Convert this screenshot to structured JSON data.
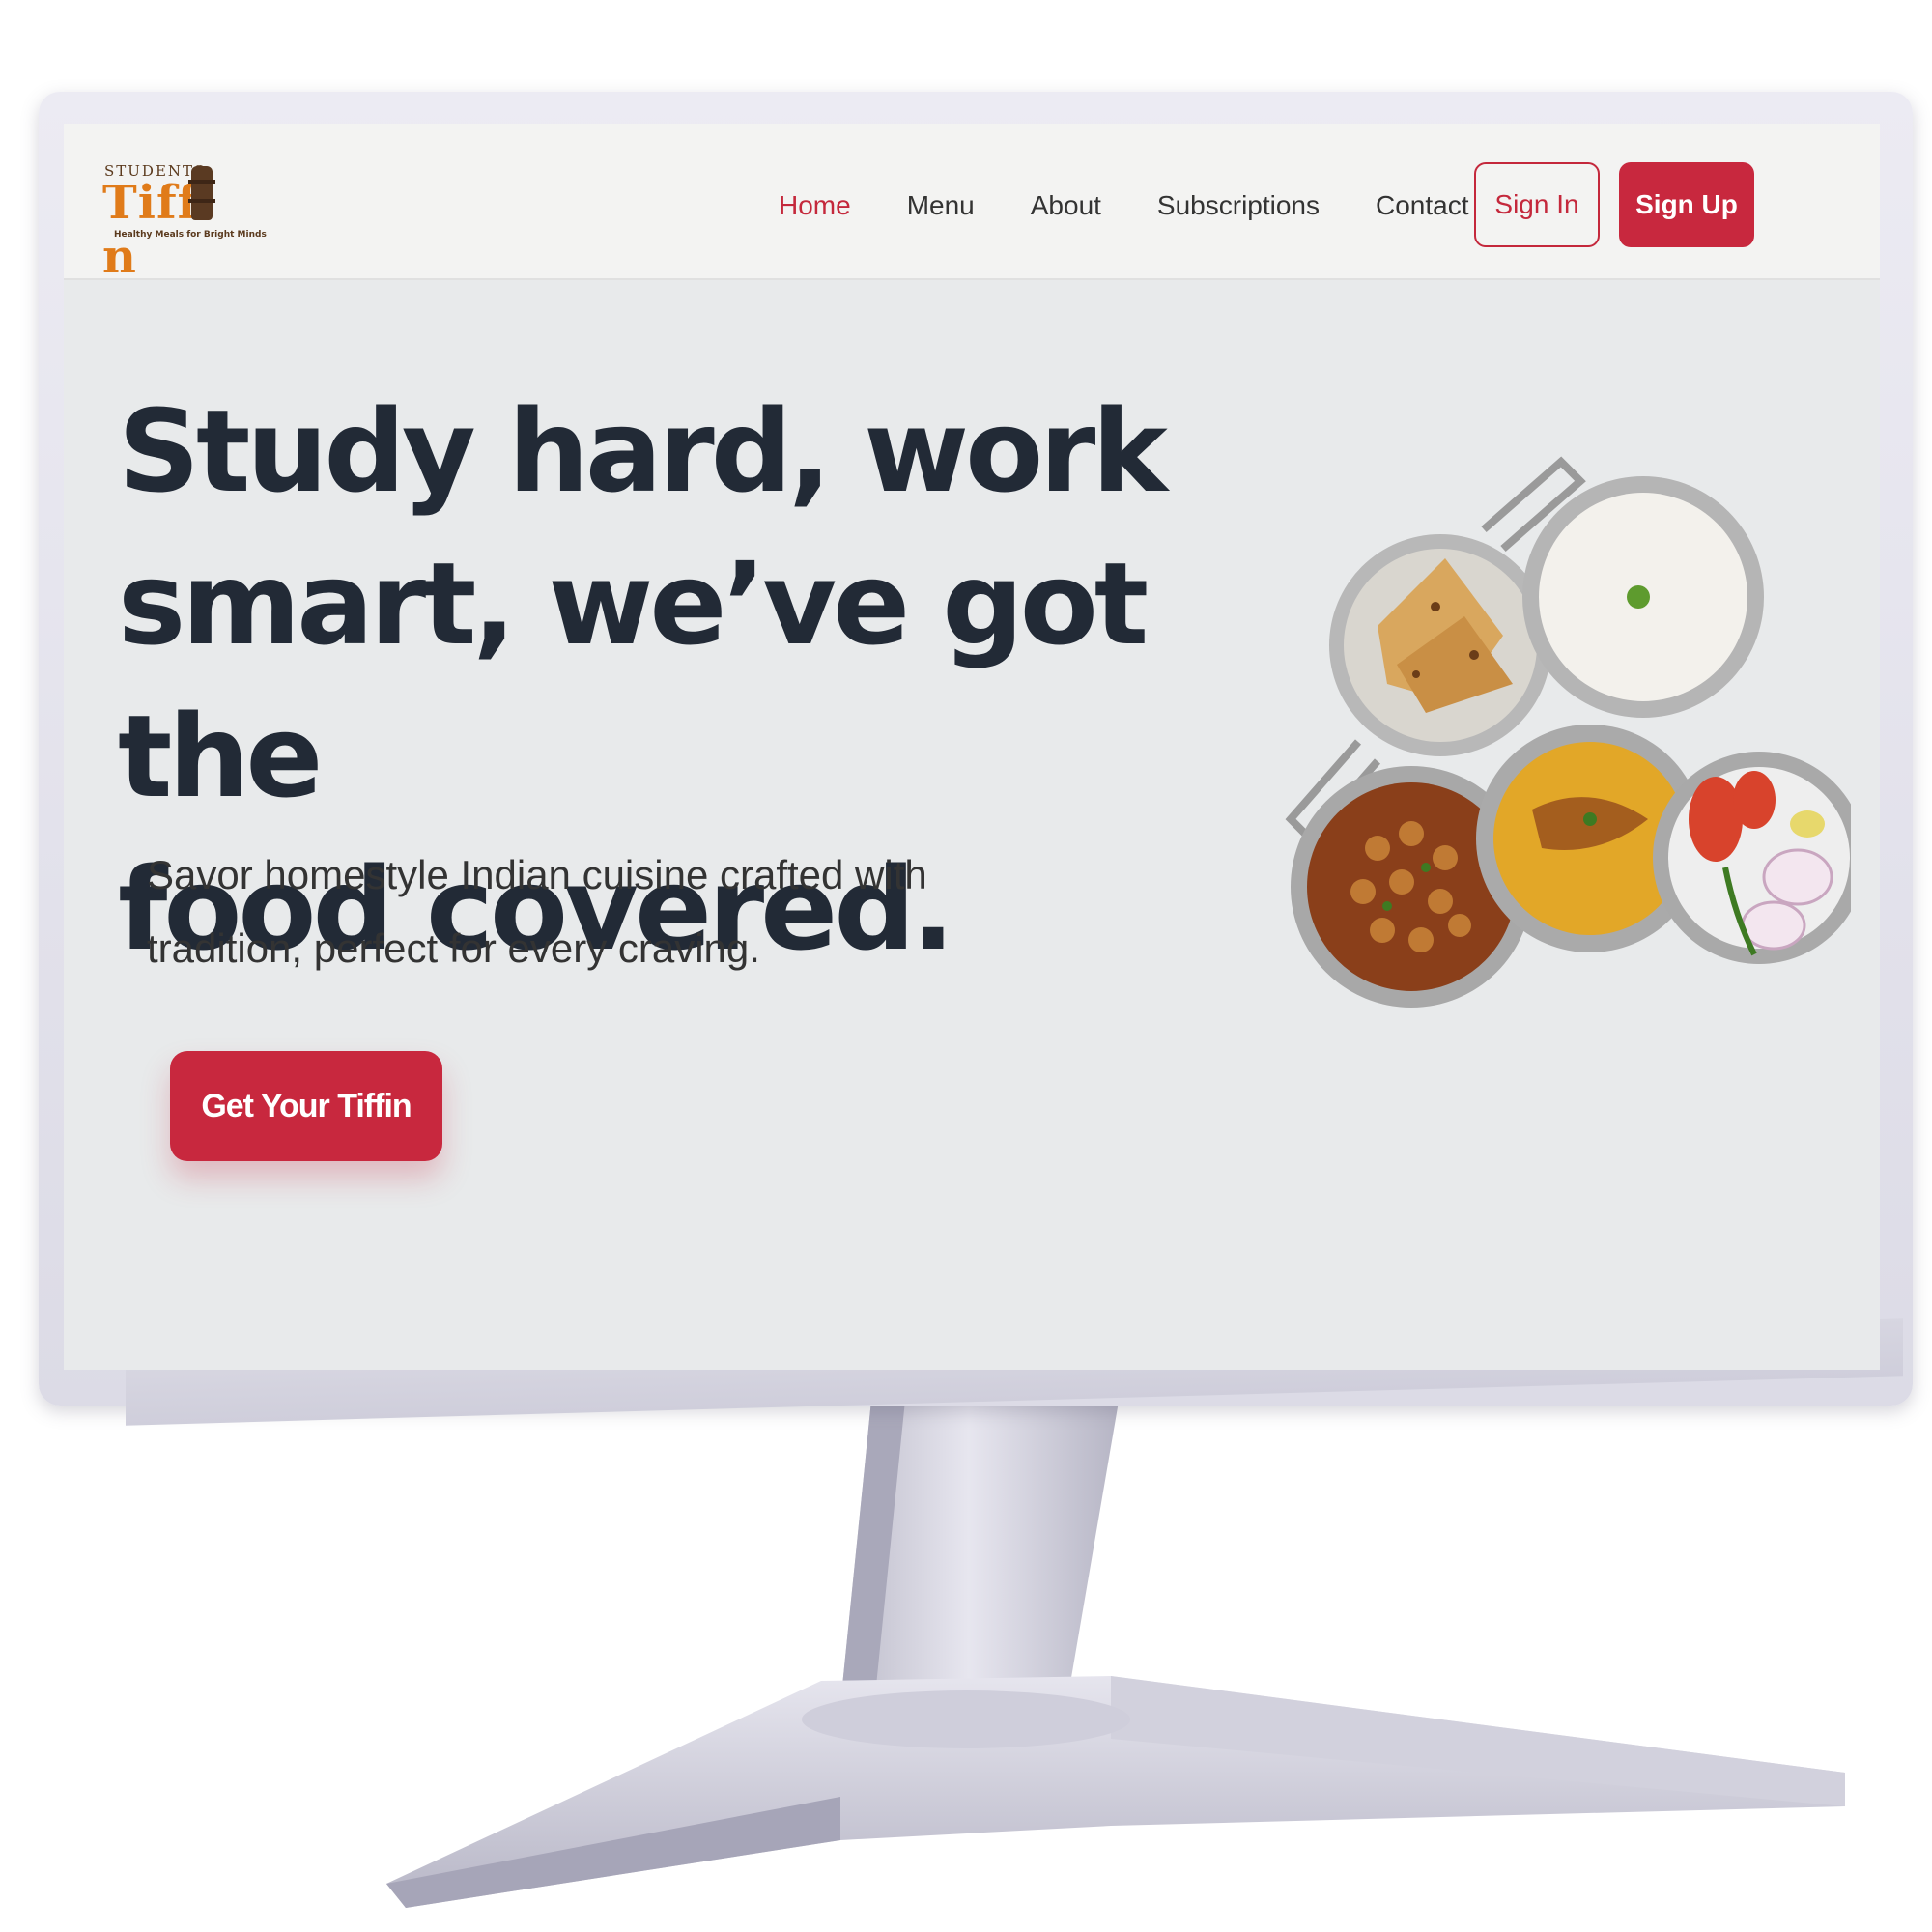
{
  "brand": {
    "small": "STUDENTS",
    "name": "Tiff  n",
    "tagline": "Healthy Meals for Bright Minds"
  },
  "nav": {
    "items": [
      {
        "label": "Home",
        "active": true
      },
      {
        "label": "Menu",
        "active": false
      },
      {
        "label": "About",
        "active": false
      },
      {
        "label": "Subscriptions",
        "active": false
      },
      {
        "label": "Contact",
        "active": false
      }
    ],
    "signin_label": "Sign In",
    "signup_label": "Sign Up"
  },
  "hero": {
    "title_line1": "Study hard, work",
    "title_line2": "smart, we’ve got the",
    "title_line3": "food covered.",
    "subtitle_line1": "Savor homestyle Indian cuisine crafted with",
    "subtitle_line2": "tradition, perfect for every craving.",
    "cta_label": "Get Your Tiffin"
  },
  "colors": {
    "accent": "#c8283e",
    "heading": "#222a36",
    "logo_orange": "#e07b1a",
    "logo_brown": "#5a3a22"
  },
  "icons": {
    "food": "tiffin-food-illustration"
  }
}
